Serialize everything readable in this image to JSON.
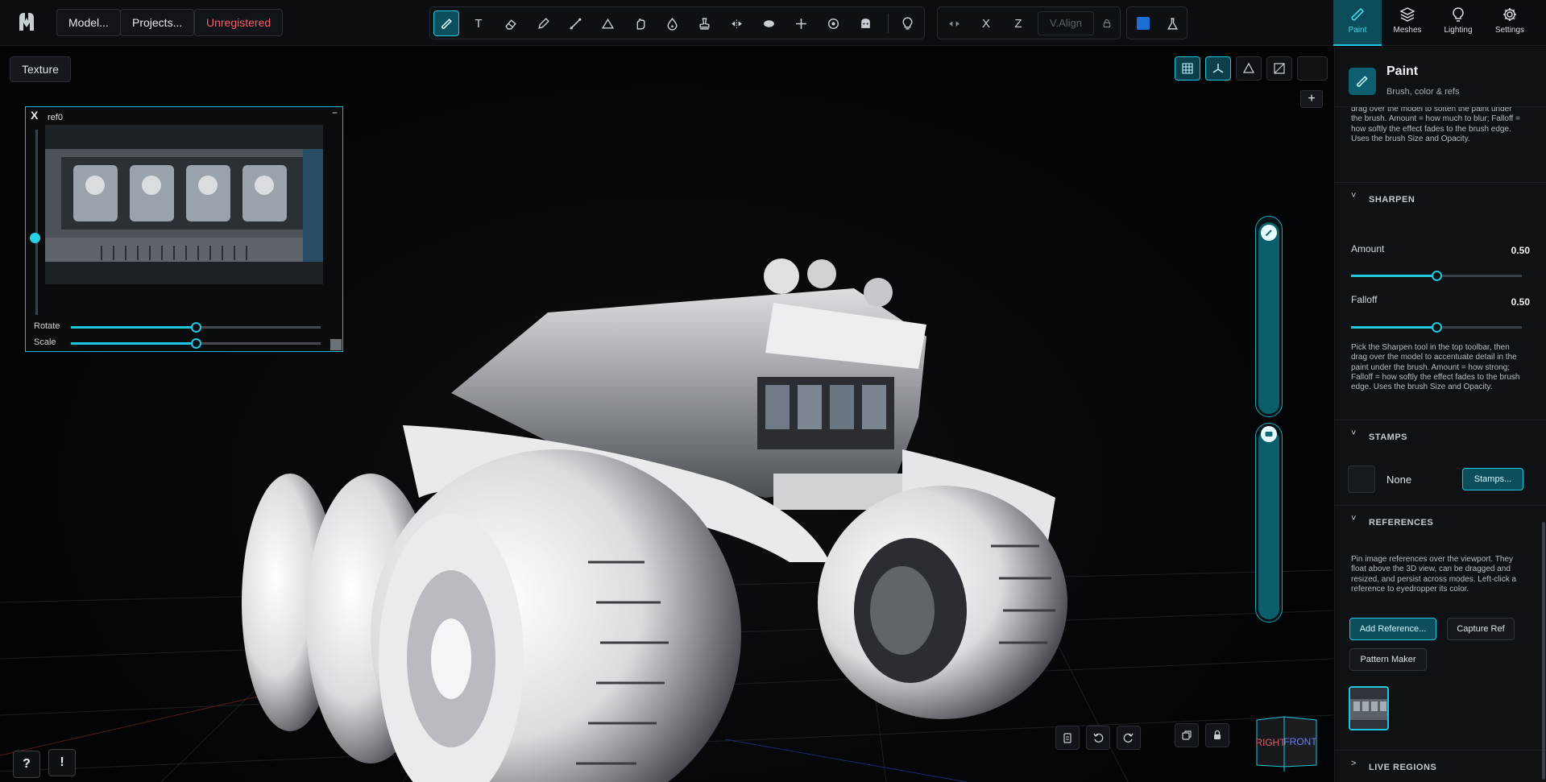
{
  "topbar": {
    "model_label": "Model...",
    "projects_label": "Projects...",
    "unregistered_label": "Unregistered",
    "axis_x": "X",
    "axis_z": "Z",
    "valign_label": "V.Align",
    "text_tool_glyph": "T",
    "active_color": "#1f6ed8"
  },
  "nav": {
    "tabs": [
      {
        "label": "Paint",
        "icon": "brush-icon",
        "active": true
      },
      {
        "label": "Meshes",
        "icon": "layers-icon"
      },
      {
        "label": "Lighting",
        "icon": "bulb-icon"
      },
      {
        "label": "Settings",
        "icon": "gear-icon"
      }
    ]
  },
  "viewport": {
    "texture_label": "Texture",
    "plus_label": "+",
    "help_label": "?",
    "alert_label": "!",
    "viewcube": {
      "right": "RIGHT",
      "front": "FRONT"
    }
  },
  "reference_window": {
    "close_label": "X",
    "name": "ref0",
    "minimize_label": "−",
    "rotate_label": "Rotate",
    "scale_label": "Scale",
    "rotate_value": 0.5,
    "scale_value": 0.5
  },
  "panel": {
    "title": "Paint",
    "subtitle": "Brush, color & refs",
    "smooth_help_tail": "drag over the model to soften the paint under the brush. Amount = how much to blur; Falloff = how softly the effect fades to the brush edge. Uses the brush Size and Opacity.",
    "sharpen": {
      "title": "SHARPEN",
      "chevron": "˅",
      "amount_label": "Amount",
      "amount_value": "0.50",
      "falloff_label": "Falloff",
      "falloff_value": "0.50",
      "help": "Pick the Sharpen tool in the top toolbar, then drag over the model to accentuate detail in the paint under the brush. Amount = how strong; Falloff = how softly the effect fades to the brush edge. Uses the brush Size and Opacity."
    },
    "stamps": {
      "title": "STAMPS",
      "chevron": "˅",
      "current": "None",
      "button": "Stamps..."
    },
    "references": {
      "title": "REFERENCES",
      "chevron": "˅",
      "help": "Pin image references over the viewport. They float above the 3D view, can be dragged and resized, and persist across modes. Left-click a reference to eyedropper its color.",
      "add_button": "Add Reference...",
      "capture_button": "Capture Ref",
      "pattern_button": "Pattern Maker"
    },
    "live_regions": {
      "title": "LIVE REGIONS",
      "chevron": ">"
    }
  }
}
